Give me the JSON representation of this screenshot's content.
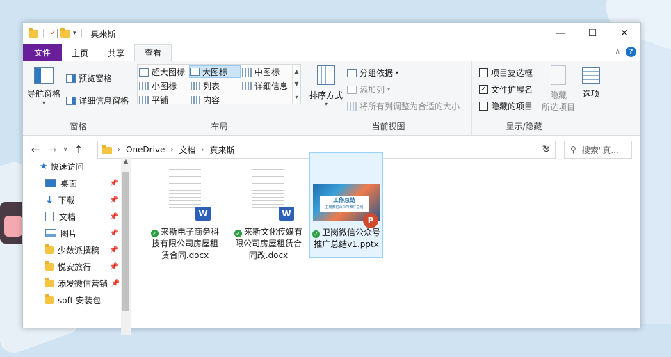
{
  "title": "真来斯",
  "qa_arrow": "▾",
  "win_controls": {
    "minimize": "—",
    "maximize": "☐",
    "close": "✕"
  },
  "tabs": [
    {
      "label": "文件"
    },
    {
      "label": "主页"
    },
    {
      "label": "共享"
    },
    {
      "label": "查看"
    }
  ],
  "ribbon": {
    "panes": {
      "nav_pane": "导航窗格",
      "preview_pane": "预览窗格",
      "details_pane": "详细信息窗格",
      "group": "窗格"
    },
    "layout": {
      "items": [
        "超大图标",
        "大图标",
        "中图标",
        "小图标",
        "列表",
        "详细信息",
        "平铺",
        "内容"
      ],
      "group": "布局"
    },
    "current_view": {
      "sort": "排序方式",
      "group_by": "分组依据",
      "add_columns": "添加列",
      "fit_columns": "将所有列调整为合适的大小",
      "group": "当前视图"
    },
    "show_hide": {
      "item_checkboxes": "项目复选框",
      "file_ext": "文件扩展名",
      "hidden_items": "隐藏的项目",
      "hide_selected_1": "隐藏",
      "hide_selected_2": "所选项目",
      "group": "显示/隐藏"
    },
    "options": "选项"
  },
  "address": {
    "crumbs": [
      "OneDrive",
      "文档",
      "真来斯"
    ],
    "search_placeholder": "搜索\"真..."
  },
  "nav": {
    "items": [
      {
        "label": "快速访问",
        "pinned": false
      },
      {
        "label": "桌面",
        "pinned": true
      },
      {
        "label": "下载",
        "pinned": true
      },
      {
        "label": "文档",
        "pinned": true
      },
      {
        "label": "图片",
        "pinned": true
      },
      {
        "label": "少数派撰稿",
        "pinned": true
      },
      {
        "label": "悦安旅行",
        "pinned": true
      },
      {
        "label": "添发微信营销",
        "pinned": true
      },
      {
        "label": "soft 安装包",
        "pinned": false
      }
    ]
  },
  "files": [
    {
      "name": "来斯电子商务科技有限公司房屋租赁合同.docx",
      "type": "docx",
      "badge": "W",
      "selected": false
    },
    {
      "name": "来斯文化传媒有限公司房屋租赁合同改.docx",
      "type": "docx",
      "badge": "W",
      "selected": false
    },
    {
      "name": "卫岗微信公众号推广总结v1.pptx",
      "type": "pptx",
      "badge": "P",
      "thumb_title": "工作总结",
      "thumb_sub": "卫岗微信公众号推广总结",
      "selected": true
    }
  ],
  "colors": {
    "file_tab": "#6a1f9a",
    "accent": "#1a73c9",
    "selection": "#e5f3ff"
  }
}
